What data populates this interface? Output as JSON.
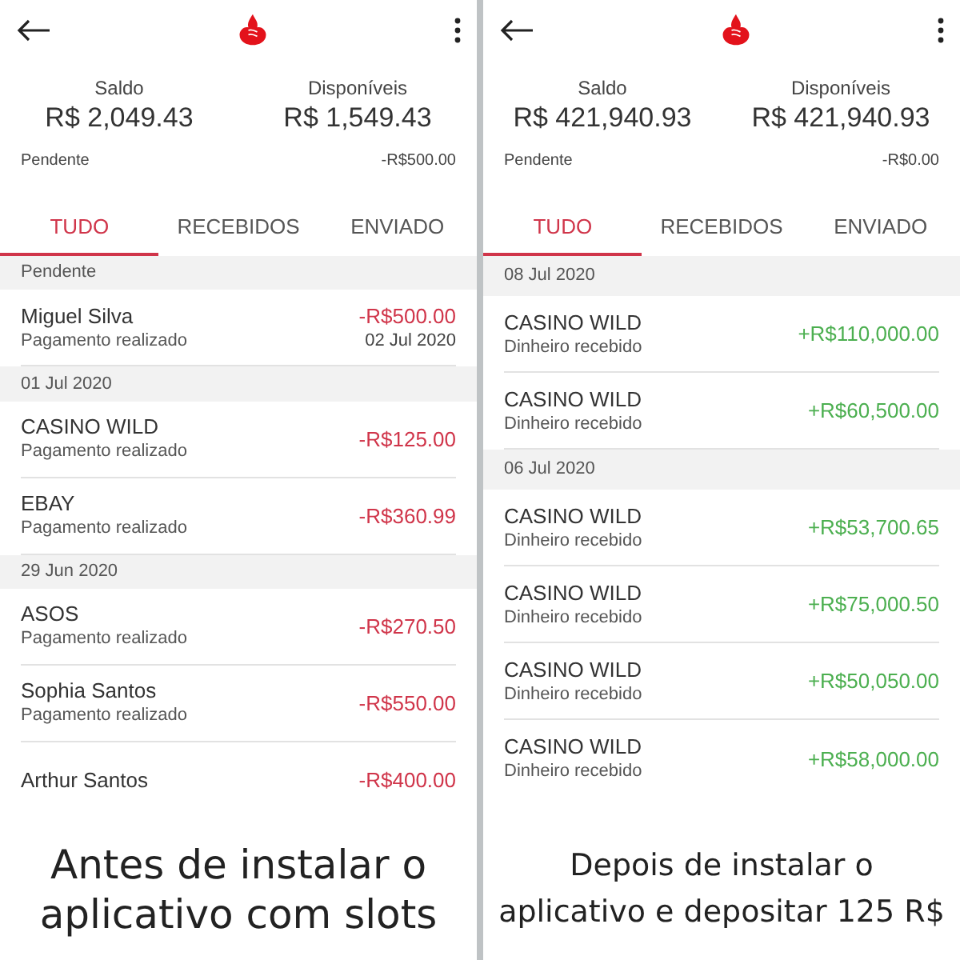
{
  "panels": [
    {
      "balances": [
        {
          "label": "Saldo",
          "amount": "R$ 2,049.43"
        },
        {
          "label": "Disponíveis",
          "amount": "R$ 1,549.43"
        }
      ],
      "pending": {
        "label": "Pendente",
        "amount": "-R$500.00"
      },
      "tabs": [
        {
          "label": "TUDO",
          "selected": true
        },
        {
          "label": "RECEBIDOS",
          "selected": false
        },
        {
          "label": "ENVIADO",
          "selected": false
        }
      ],
      "items": [
        {
          "kind": "header",
          "title": "Pendente"
        },
        {
          "kind": "debit",
          "title": "Miguel Silva",
          "subtitle": "Pagamento realizado",
          "amount": "-R$500.00",
          "date": "02 Jul 2020"
        },
        {
          "kind": "header",
          "title": "01 Jul 2020"
        },
        {
          "kind": "debit",
          "title": "CASINO WILD",
          "subtitle": "Pagamento realizado",
          "amount": "-R$125.00"
        },
        {
          "kind": "debit",
          "title": "EBAY",
          "subtitle": "Pagamento realizado",
          "amount": "-R$360.99"
        },
        {
          "kind": "header",
          "title": "29 Jun 2020"
        },
        {
          "kind": "debit",
          "title": "ASOS",
          "subtitle": "Pagamento realizado",
          "amount": "-R$270.50"
        },
        {
          "kind": "debit",
          "title": "Sophia Santos",
          "subtitle": "Pagamento realizado",
          "amount": "-R$550.00"
        },
        {
          "kind": "debit",
          "title": "Arthur Santos",
          "amount": "-R$400.00"
        }
      ],
      "caption": {
        "kind": "large",
        "text": "Antes de instalar o aplicativo com slots"
      }
    },
    {
      "balances": [
        {
          "label": "Saldo",
          "amount": "R$ 421,940.93"
        },
        {
          "label": "Disponíveis",
          "amount": "R$ 421,940.93"
        }
      ],
      "pending": {
        "label": "Pendente",
        "amount": "-R$0.00"
      },
      "tabs": [
        {
          "label": "TUDO",
          "selected": true
        },
        {
          "label": "RECEBIDOS",
          "selected": false
        },
        {
          "label": "ENVIADO",
          "selected": false
        }
      ],
      "items": [
        {
          "kind": "header",
          "title": "08 Jul 2020"
        },
        {
          "kind": "credit",
          "title": "CASINO WILD",
          "subtitle": "Dinheiro recebido",
          "amount": "+R$110,000.00"
        },
        {
          "kind": "credit",
          "title": "CASINO WILD",
          "subtitle": "Dinheiro recebido",
          "amount": "+R$60,500.00"
        },
        {
          "kind": "header",
          "title": "06 Jul 2020"
        },
        {
          "kind": "credit",
          "title": "CASINO WILD",
          "subtitle": "Dinheiro recebido",
          "amount": "+R$53,700.65"
        },
        {
          "kind": "credit",
          "title": "CASINO WILD",
          "subtitle": "Dinheiro recebido",
          "amount": "+R$75,000.50"
        },
        {
          "kind": "credit",
          "title": "CASINO WILD",
          "subtitle": "Dinheiro recebido",
          "amount": "+R$50,050.00"
        },
        {
          "kind": "credit",
          "title": "CASINO WILD",
          "subtitle": "Dinheiro recebido",
          "amount": "+R$58,000.00"
        }
      ],
      "caption": {
        "kind": "small",
        "text": "Depois de instalar o aplicativo e depositar 125 R$"
      }
    }
  ]
}
